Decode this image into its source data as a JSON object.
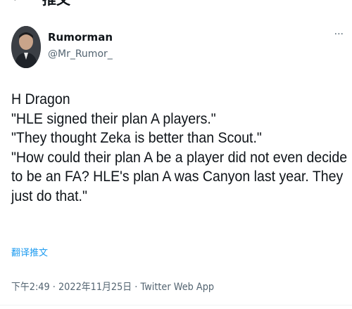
{
  "header": {
    "back_icon": "back-arrow-icon",
    "title": "推文"
  },
  "author": {
    "display_name": "Rumorman",
    "handle": "@Mr_Rumor_",
    "more_label": "···"
  },
  "tweet": {
    "lines": [
      "H Dragon",
      "\"HLE signed their plan A players.\"",
      "\"They thought Zeka is better than Scout.\"",
      "\"How could their plan A be a player did not even decide",
      "to be an FA? HLE's plan A was Canyon last year. They",
      "just do that.\""
    ],
    "translate_label": "翻译推文"
  },
  "meta": {
    "time": "下午2:49",
    "separator": " · ",
    "date": "2022年11月25日",
    "source": "Twitter Web App"
  },
  "colors": {
    "text": "#0f1419",
    "secondary": "#536471",
    "link": "#1d9bf0"
  }
}
